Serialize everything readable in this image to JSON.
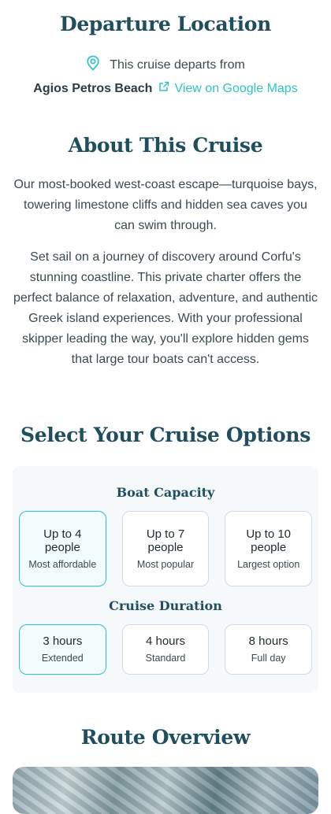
{
  "departure": {
    "title": "Departure Location",
    "departs_text": "This cruise departs from",
    "location_name": "Agios Petros Beach",
    "maps_link_label": "View on Google Maps"
  },
  "about": {
    "title": "About This Cruise",
    "paragraph_1": "Our most-booked west-coast escape—turquoise bays, towering limestone cliffs and hidden sea caves you can swim through.",
    "paragraph_2": "Set sail on a journey of discovery around Corfu's stunning coastline. This private charter offers the perfect balance of relaxation, adventure, and authentic Greek island experiences. With your professional skipper leading the way, you'll explore hidden gems that large tour boats can't access."
  },
  "options": {
    "title": "Select Your Cruise Options",
    "capacity": {
      "title": "Boat Capacity",
      "items": [
        {
          "main": "Up to 4 people",
          "sub": "Most affordable",
          "selected": true
        },
        {
          "main": "Up to 7 people",
          "sub": "Most popular",
          "selected": false
        },
        {
          "main": "Up to 10 people",
          "sub": "Largest option",
          "selected": false
        }
      ]
    },
    "duration": {
      "title": "Cruise Duration",
      "items": [
        {
          "main": "3 hours",
          "sub": "Extended",
          "selected": true
        },
        {
          "main": "4 hours",
          "sub": "Standard",
          "selected": false
        },
        {
          "main": "8 hours",
          "sub": "Full day",
          "selected": false
        }
      ]
    }
  },
  "route": {
    "title": "Route Overview"
  },
  "colors": {
    "accent": "#2ec4c4",
    "heading": "#1f4e5f",
    "panel_bg": "#f5f9fb"
  },
  "icons": {
    "location": "map-pin-icon",
    "external": "external-link-icon"
  }
}
